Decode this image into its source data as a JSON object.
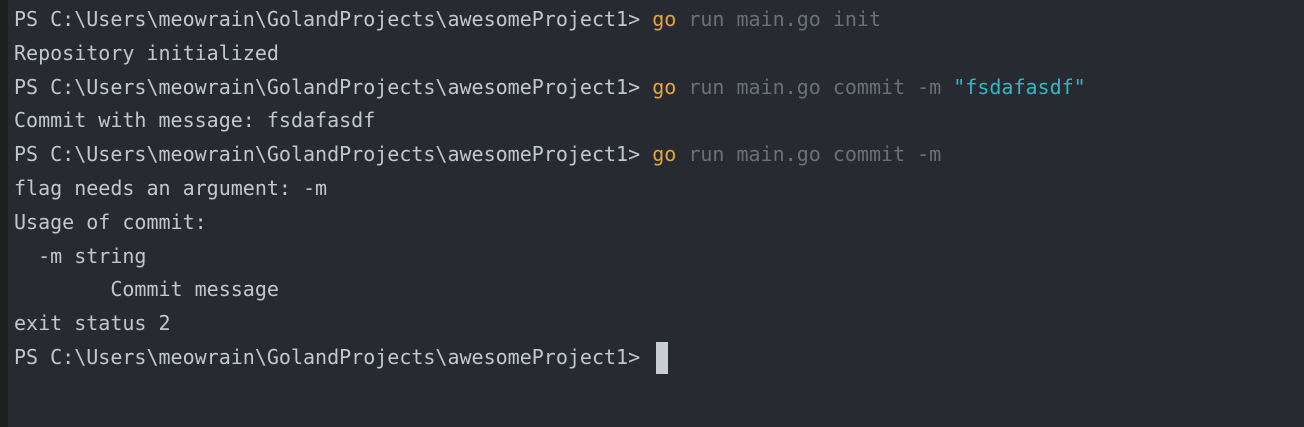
{
  "prompt": "PS C:\\Users\\meowrain\\GolandProjects\\awesomeProject1> ",
  "lines": [
    {
      "type": "cmd",
      "kw": "go",
      "args": " run main.go init",
      "str": ""
    },
    {
      "type": "out",
      "text": "Repository initialized"
    },
    {
      "type": "cmd",
      "kw": "go",
      "args": " run main.go commit -m ",
      "str": "\"fsdafasdf\""
    },
    {
      "type": "out",
      "text": "Commit with message: fsdafasdf"
    },
    {
      "type": "cmd",
      "kw": "go",
      "args": " run main.go commit -m",
      "str": ""
    },
    {
      "type": "out",
      "text": "flag needs an argument: -m"
    },
    {
      "type": "out",
      "text": "Usage of commit:"
    },
    {
      "type": "out",
      "text": "  -m string"
    },
    {
      "type": "out",
      "text": "        Commit message"
    },
    {
      "type": "out",
      "text": "exit status 2"
    },
    {
      "type": "prompt"
    }
  ],
  "colors": {
    "background": "#282a31",
    "text": "#c2c6ce",
    "keyword": "#e4a63c",
    "args": "#6b6f77",
    "string": "#2fb8c6",
    "cursor": "#c9cdd4"
  }
}
